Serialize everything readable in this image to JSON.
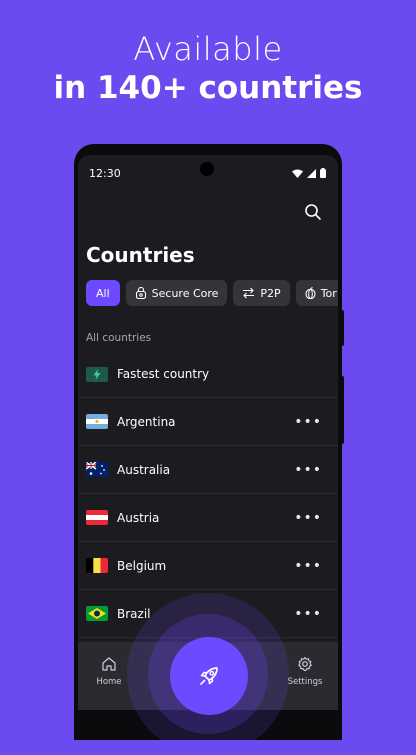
{
  "headline": {
    "line1": "Available",
    "line2": "in 140+ countries"
  },
  "status_bar": {
    "time": "12:30"
  },
  "page": {
    "title": "Countries"
  },
  "filters": [
    "All",
    "Secure Core",
    "P2P",
    "Tor"
  ],
  "section_label": "All countries",
  "fastest": {
    "label": "Fastest country",
    "icon": "bolt-icon"
  },
  "countries": [
    {
      "name": "Argentina",
      "flag": "argentina-flag"
    },
    {
      "name": "Australia",
      "flag": "australia-flag"
    },
    {
      "name": "Austria",
      "flag": "austria-flag"
    },
    {
      "name": "Belgium",
      "flag": "belgium-flag"
    },
    {
      "name": "Brazil",
      "flag": "brazil-flag"
    }
  ],
  "more_glyph": "•••",
  "nav": {
    "home": "Home",
    "settings": "Settings"
  },
  "colors": {
    "background": "#6b4af0",
    "accent": "#6d4aff",
    "screen": "#1c1b20"
  }
}
